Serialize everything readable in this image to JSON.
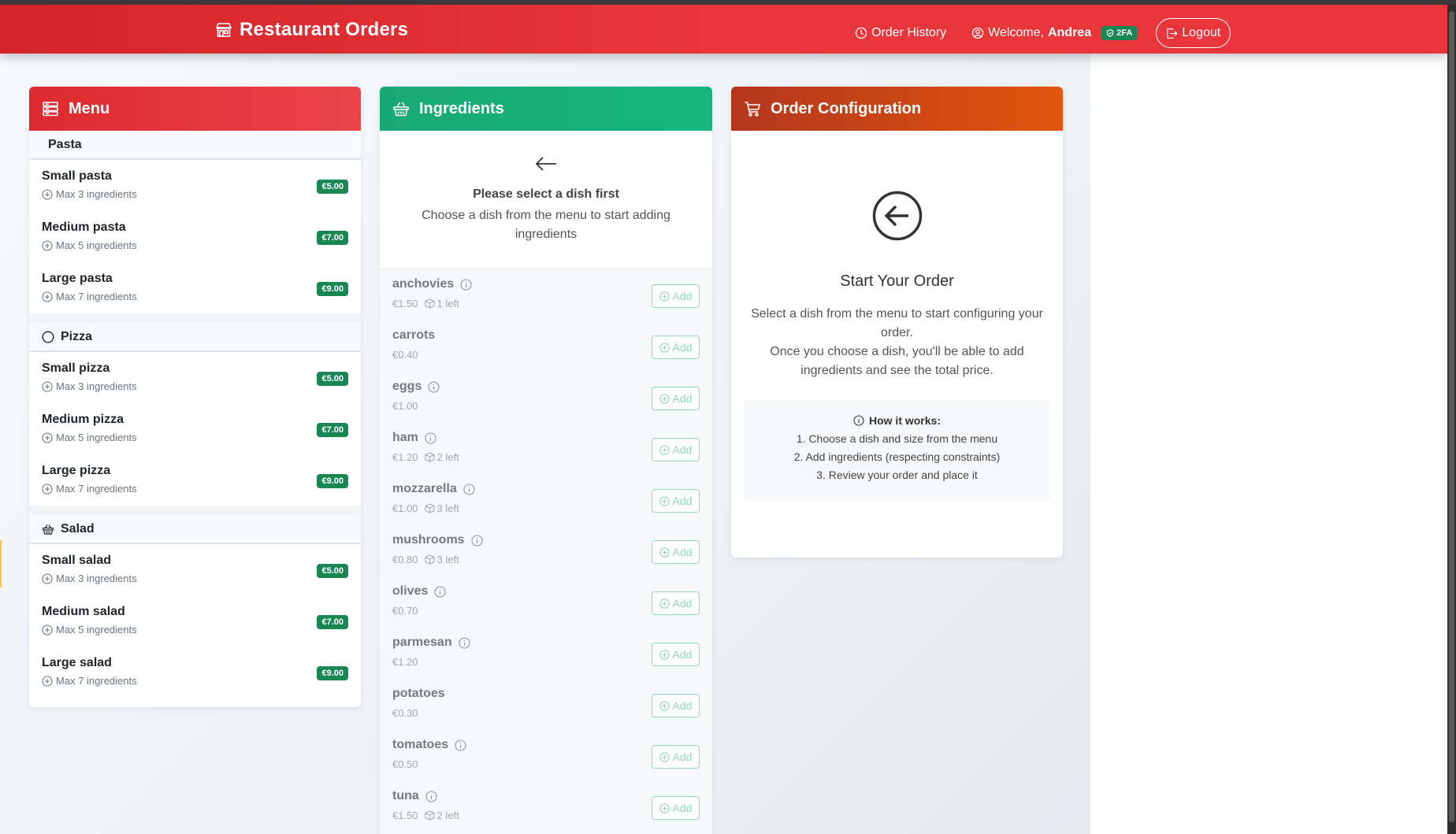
{
  "navbar": {
    "brand": "Restaurant Orders",
    "order_history": "Order History",
    "welcome_prefix": "Welcome,",
    "user_name": "Andrea",
    "badge_2fa": "2FA",
    "logout": "Logout"
  },
  "menu": {
    "title": "Menu",
    "categories": [
      {
        "name": "Pasta",
        "icon": "pasta",
        "dishes": [
          {
            "name": "Small pasta",
            "max": "Max 3 ingredients",
            "price": "€5.00"
          },
          {
            "name": "Medium pasta",
            "max": "Max 5 ingredients",
            "price": "€7.00"
          },
          {
            "name": "Large pasta",
            "max": "Max 7 ingredients",
            "price": "€9.00"
          }
        ]
      },
      {
        "name": "Pizza",
        "icon": "circle-icon",
        "dishes": [
          {
            "name": "Small pizza",
            "max": "Max 3 ingredients",
            "price": "€5.00"
          },
          {
            "name": "Medium pizza",
            "max": "Max 5 ingredients",
            "price": "€7.00"
          },
          {
            "name": "Large pizza",
            "max": "Max 7 ingredients",
            "price": "€9.00"
          }
        ]
      },
      {
        "name": "Salad",
        "icon": "basket-icon",
        "dishes": [
          {
            "name": "Small salad",
            "max": "Max 3 ingredients",
            "price": "€5.00"
          },
          {
            "name": "Medium salad",
            "max": "Max 5 ingredients",
            "price": "€7.00"
          },
          {
            "name": "Large salad",
            "max": "Max 7 ingredients",
            "price": "€9.00"
          }
        ]
      }
    ]
  },
  "ingredients": {
    "title": "Ingredients",
    "empty_title": "Please select a dish first",
    "empty_desc": "Choose a dish from the menu to start adding ingredients",
    "add_label": "Add",
    "items": [
      {
        "name": "anchovies",
        "price": "€1.50",
        "stock": "1 left",
        "info": true
      },
      {
        "name": "carrots",
        "price": "€0.40",
        "stock": "",
        "info": false
      },
      {
        "name": "eggs",
        "price": "€1.00",
        "stock": "",
        "info": true
      },
      {
        "name": "ham",
        "price": "€1.20",
        "stock": "2 left",
        "info": true
      },
      {
        "name": "mozzarella",
        "price": "€1.00",
        "stock": "3 left",
        "info": true
      },
      {
        "name": "mushrooms",
        "price": "€0.80",
        "stock": "3 left",
        "info": true
      },
      {
        "name": "olives",
        "price": "€0.70",
        "stock": "",
        "info": true
      },
      {
        "name": "parmesan",
        "price": "€1.20",
        "stock": "",
        "info": true
      },
      {
        "name": "potatoes",
        "price": "€0.30",
        "stock": "",
        "info": false
      },
      {
        "name": "tomatoes",
        "price": "€0.50",
        "stock": "",
        "info": true
      },
      {
        "name": "tuna",
        "price": "€1.50",
        "stock": "2 left",
        "info": true
      }
    ]
  },
  "order": {
    "title": "Order Configuration",
    "start_title": "Start Your Order",
    "desc_line1": "Select a dish from the menu to start configuring your order.",
    "desc_line2": "Once you choose a dish, you'll be able to add ingredients and see the total price.",
    "how_title": "How it works:",
    "steps": [
      "1. Choose a dish and size from the menu",
      "2. Add ingredients (respecting constraints)",
      "3. Review your order and place it"
    ]
  },
  "colors": {
    "navbar": "#e33238",
    "menu_header": "#e0333a",
    "ingredients_header": "#17b07a",
    "order_header": "#c8461a",
    "price_badge": "#198754"
  }
}
